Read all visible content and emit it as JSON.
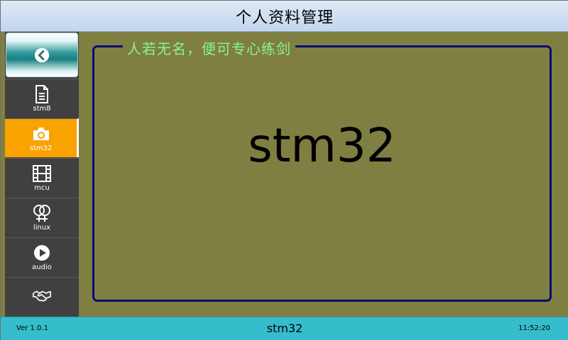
{
  "window": {
    "title": "个人资料管理"
  },
  "sidebar": {
    "back_icon": "chevron-left-circle-icon",
    "items": [
      {
        "label": "stm8",
        "icon": "document-icon",
        "active": false
      },
      {
        "label": "stm32",
        "icon": "camera-icon",
        "active": true
      },
      {
        "label": "mcu",
        "icon": "film-icon",
        "active": false
      },
      {
        "label": "linux",
        "icon": "venus-double-icon",
        "active": false
      },
      {
        "label": "audio",
        "icon": "play-icon",
        "active": false
      },
      {
        "label": "",
        "icon": "handshake-icon",
        "active": false
      }
    ]
  },
  "main": {
    "panel_title": "人若无名，便可专心练剑",
    "content_text": "stm32"
  },
  "status": {
    "version": "Ver 1.0.1",
    "center": "stm32",
    "time": "11:52:20"
  },
  "colors": {
    "accent": "#f9a200",
    "sidebar_bg": "#404040",
    "content_bg": "#7f7f42",
    "panel_border": "#0a0a78",
    "panel_title": "#88f788",
    "status_bg": "#35bdcb"
  }
}
